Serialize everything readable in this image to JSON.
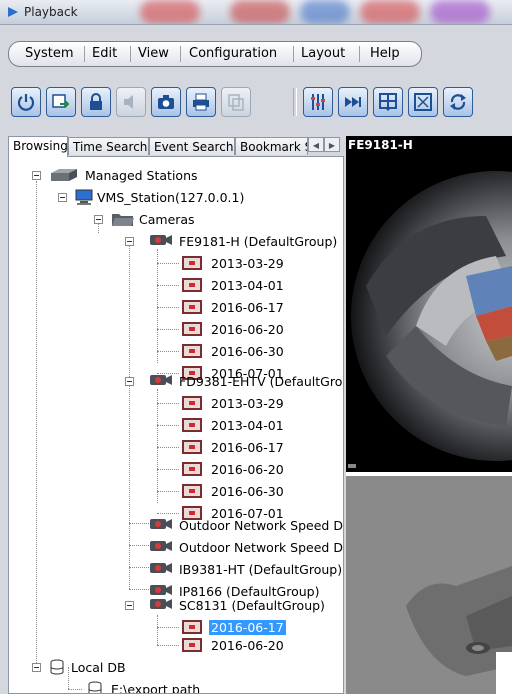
{
  "window": {
    "title": "Playback"
  },
  "menu": {
    "items": [
      "System",
      "Edit",
      "View",
      "Configuration",
      "Layout",
      "Help"
    ]
  },
  "toolbar": {
    "buttons": [
      "power-icon",
      "export-icon",
      "lock-icon",
      "audio-icon",
      "snapshot-icon",
      "print-icon",
      "copy-icon",
      "filter-icon",
      "forward-icon",
      "layout-icon",
      "fullscreen-icon",
      "refresh-icon"
    ]
  },
  "tabs": [
    "Browsing",
    "Time Search",
    "Event Search",
    "Bookmark S"
  ],
  "tree": {
    "root": "Managed Stations",
    "station": "VMS_Station(127.0.0.1)",
    "cameras_folder": "Cameras",
    "cam1": {
      "name": "FE9181-H (DefaultGroup)",
      "dates": [
        "2013-03-29",
        "2013-04-01",
        "2016-06-17",
        "2016-06-20",
        "2016-06-30",
        "2016-07-01"
      ]
    },
    "cam2": {
      "name": "FD9381-EHTV (DefaultGrou",
      "dates": [
        "2013-03-29",
        "2013-04-01",
        "2016-06-17",
        "2016-06-20",
        "2016-06-30",
        "2016-07-01"
      ]
    },
    "cam3": "Outdoor Network Speed D",
    "cam4": "Outdoor Network Speed D",
    "cam5": "IB9381-HT (DefaultGroup)",
    "cam6": "IP8166 (DefaultGroup)",
    "cam7": {
      "name": "SC8131 (DefaultGroup)",
      "dates": [
        "2016-06-17",
        "2016-06-20"
      ],
      "selected": "2016-06-17"
    },
    "localdb": "Local DB",
    "export": "E:\\export path"
  },
  "video": {
    "title": "FE9181-H"
  },
  "colors": {
    "selection": "#3399ff",
    "toolbar_border": "#2f5c99"
  }
}
